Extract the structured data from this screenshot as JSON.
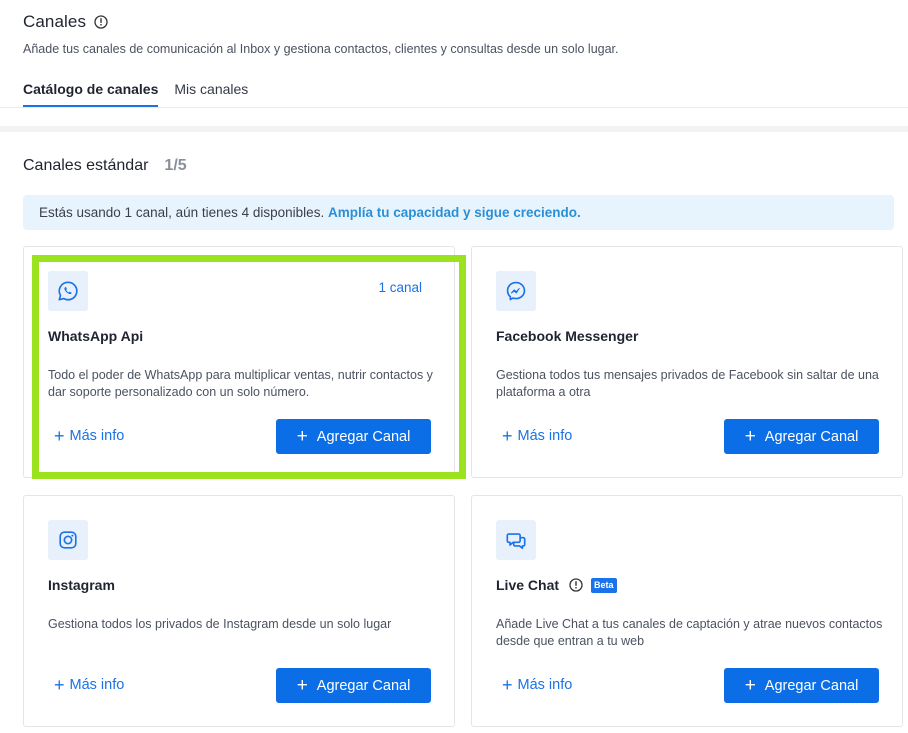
{
  "header": {
    "title": "Canales",
    "subtitle": "Añade tus canales de comunicación al Inbox y gestiona contactos, clientes y consultas desde un solo lugar.",
    "tabs": [
      {
        "label": "Catálogo de canales",
        "active": true
      },
      {
        "label": "Mis canales",
        "active": false
      }
    ]
  },
  "section": {
    "title": "Canales estándar",
    "count": "1/5"
  },
  "notice": {
    "text": "Estás usando 1 canal, aún tienes 4 disponibles.",
    "link": "Amplía tu capacidad y sigue creciendo."
  },
  "cards": [
    {
      "name": "WhatsApp Api",
      "icon": "whatsapp-icon",
      "count": "1 canal",
      "description": "Todo el poder de WhatsApp para multiplicar ventas, nutrir contactos y dar soporte personalizado con un solo número.",
      "more_label": "Más info",
      "add_label": "Agregar Canal"
    },
    {
      "name": "Facebook Messenger",
      "icon": "messenger-icon",
      "description": "Gestiona todos tus mensajes privados de Facebook sin saltar de una plataforma a otra",
      "more_label": "Más info",
      "add_label": "Agregar Canal"
    },
    {
      "name": "Instagram",
      "icon": "instagram-icon",
      "description": "Gestiona todos los privados de Instagram desde un solo lugar",
      "more_label": "Más info",
      "add_label": "Agregar Canal"
    },
    {
      "name": "Live Chat",
      "icon": "chat-bubbles-icon",
      "badge": "Beta",
      "description": "Añade Live Chat a tus canales de captación y atrae nuevos contactos desde que entran a tu web",
      "more_label": "Más info",
      "add_label": "Agregar Canal"
    }
  ],
  "colors": {
    "accent": "#0b6ee6",
    "highlight": "#9be31f",
    "notice_bg": "#e8f4fd"
  }
}
